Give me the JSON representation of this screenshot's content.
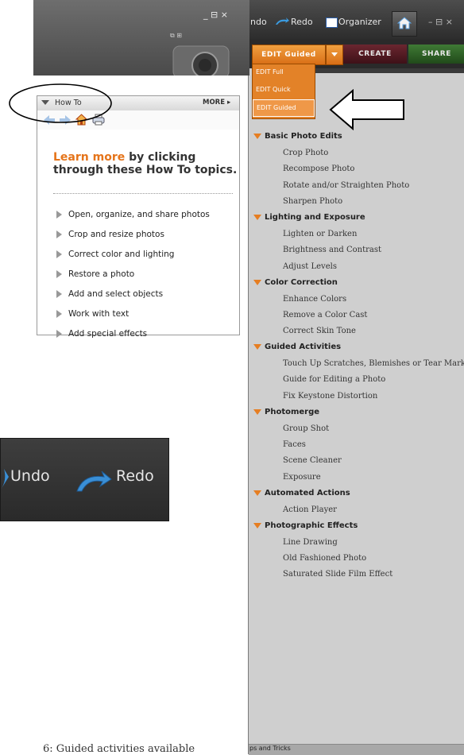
{
  "topbar": {
    "undo_partial": "ndo",
    "redo": "Redo",
    "organizer": "Organizer",
    "win_controls": "– ⊟ ×"
  },
  "tabs": {
    "edit_guided": "EDIT Guided",
    "create": "CREATE",
    "share": "SHARE"
  },
  "dropdown": {
    "items": [
      "EDIT Full",
      "EDIT Quick",
      "EDIT Guided"
    ]
  },
  "guided": {
    "categories": [
      {
        "title": "Basic Photo Edits",
        "items": [
          "Crop Photo",
          "Recompose Photo",
          "Rotate and/or Straighten Photo",
          "Sharpen Photo"
        ]
      },
      {
        "title": "Lighting and Exposure",
        "items": [
          "Lighten or Darken",
          "Brightness and Contrast",
          "Adjust Levels"
        ]
      },
      {
        "title": "Color Correction",
        "items": [
          "Enhance Colors",
          "Remove a Color Cast",
          "Correct Skin Tone"
        ]
      },
      {
        "title": "Guided Activities",
        "items": [
          "Touch Up Scratches, Blemishes or Tear Marks",
          "Guide for Editing a Photo",
          "Fix Keystone Distortion"
        ]
      },
      {
        "title": "Photomerge",
        "items": [
          "Group Shot",
          "Faces",
          "Scene Cleaner",
          "Exposure"
        ]
      },
      {
        "title": "Automated Actions",
        "items": [
          "Action Player"
        ]
      },
      {
        "title": "Photographic Effects",
        "items": [
          "Line Drawing",
          "Old Fashioned Photo",
          "Saturated Slide Film Effect"
        ]
      }
    ],
    "footer": "ps and Tricks"
  },
  "howto": {
    "win_controls": "_ ⊟ ×",
    "title": "How To",
    "more": "MORE ▸",
    "heading_accent": "Learn more",
    "heading_rest1": " by clicking",
    "heading_line2": "through these How To topics.",
    "links": [
      "Open, organize, and share photos",
      "Crop and resize photos",
      "Correct color and lighting",
      "Restore a photo",
      "Add and select objects",
      "Work with text",
      "Add special effects"
    ]
  },
  "zoom": {
    "undo": "Undo",
    "redo": "Redo"
  },
  "caption_partial": "6: Guided activities available"
}
